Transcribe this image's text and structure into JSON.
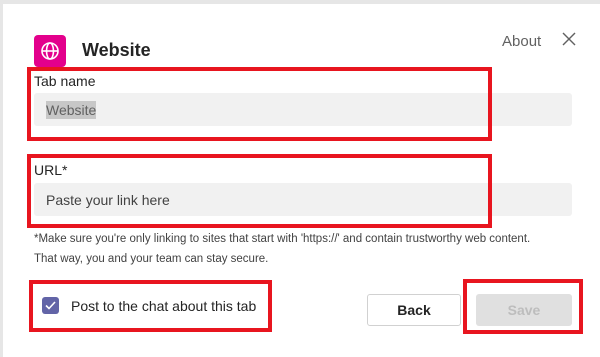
{
  "dialog": {
    "title": "Website",
    "about_label": "About",
    "app_icon": "globe-icon",
    "close_icon": "close-icon"
  },
  "tab_name": {
    "label": "Tab name",
    "value": "Website"
  },
  "url": {
    "label": "URL*",
    "placeholder": "Paste your link here"
  },
  "helper_text": {
    "line1": "*Make sure you're only linking to sites that start with 'https://' and contain trustworthy web content.",
    "line2": "That way, you and your team can stay secure."
  },
  "post_to_chat": {
    "label": "Post to the chat about this tab",
    "checked": true
  },
  "buttons": {
    "back_label": "Back",
    "save_label": "Save"
  },
  "colors": {
    "app_icon_bg": "#e3008c",
    "checkbox_accent": "#6264a7",
    "highlight": "#e8151f"
  }
}
